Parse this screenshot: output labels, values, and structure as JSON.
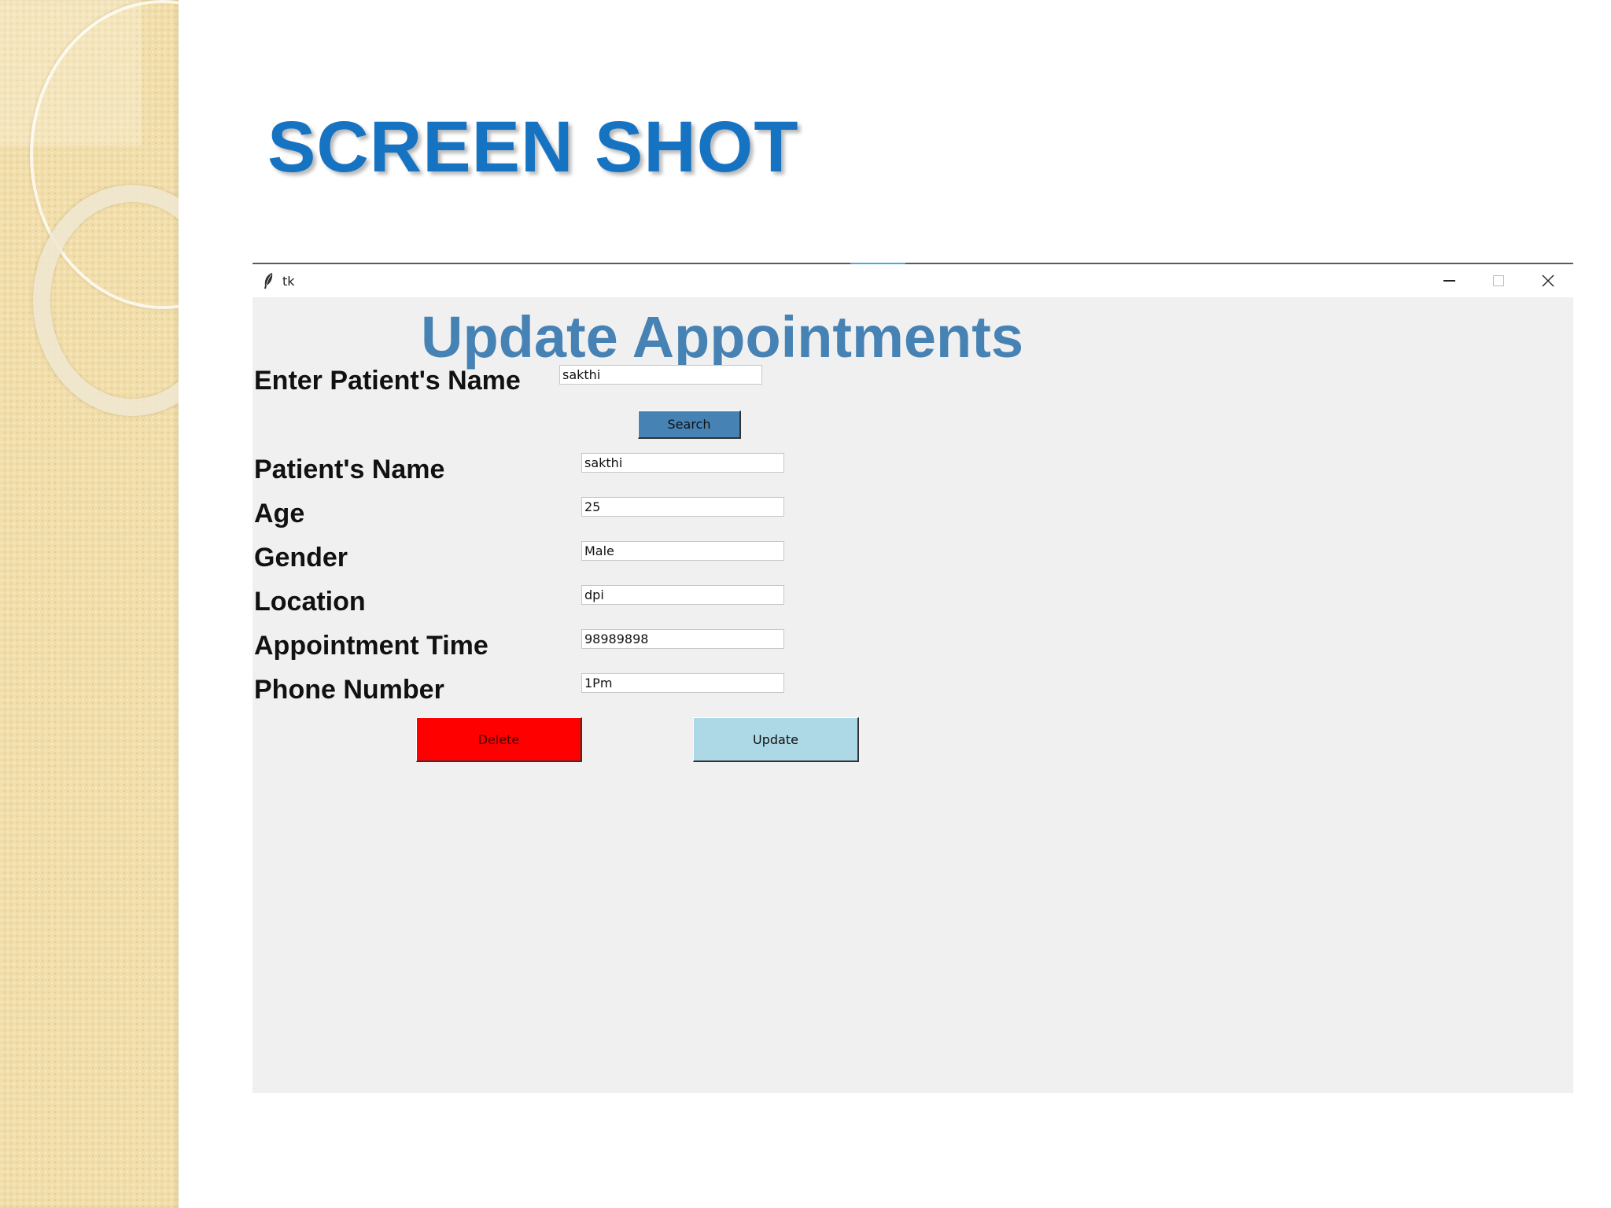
{
  "slide": {
    "title": "SCREEN SHOT"
  },
  "window": {
    "title": "tk",
    "controls": {
      "minimize": "minimize-icon",
      "maximize": "maximize-icon",
      "close": "close-icon"
    }
  },
  "form": {
    "heading": "Update Appointments",
    "search_label": "Enter Patient's Name",
    "search_value": "sakthi",
    "search_button": "Search",
    "fields": [
      {
        "label": "Patient's Name",
        "value": "sakthi"
      },
      {
        "label": "Age",
        "value": "25"
      },
      {
        "label": "Gender",
        "value": "Male"
      },
      {
        "label": "Location",
        "value": "dpi"
      },
      {
        "label": "Appointment Time",
        "value": "98989898"
      },
      {
        "label": "Phone Number",
        "value": "1Pm"
      }
    ],
    "delete_button": "Delete",
    "update_button": "Update"
  },
  "colors": {
    "slide_title": "#1573c2",
    "heading": "#4682b4",
    "search_button": "#4682b4",
    "delete_button": "#ff0000",
    "update_button": "#add8e6",
    "window_bg": "#f0f0f0"
  }
}
